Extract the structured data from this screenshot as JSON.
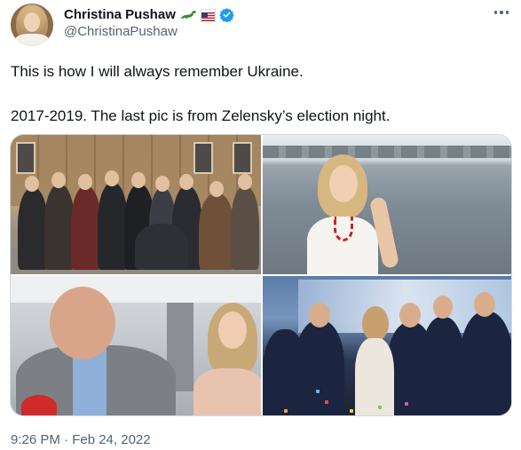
{
  "author": {
    "display_name": "Christina Pushaw",
    "handle": "@ChristinaPushaw",
    "badges": [
      "dinosaur-emoji",
      "us-flag-emoji",
      "verified-badge"
    ]
  },
  "tweet": {
    "line1": "This is how I will always remember Ukraine.",
    "line2": "2017-2019. The last pic is from Zelensky’s election night.",
    "timestamp": "9:26 PM · Feb 24, 2022"
  },
  "media": {
    "photo_count": 4
  },
  "colors": {
    "text_primary": "#0f1419",
    "text_secondary": "#536471",
    "verified_blue": "#1d9bf0",
    "border": "#cfd9de"
  }
}
